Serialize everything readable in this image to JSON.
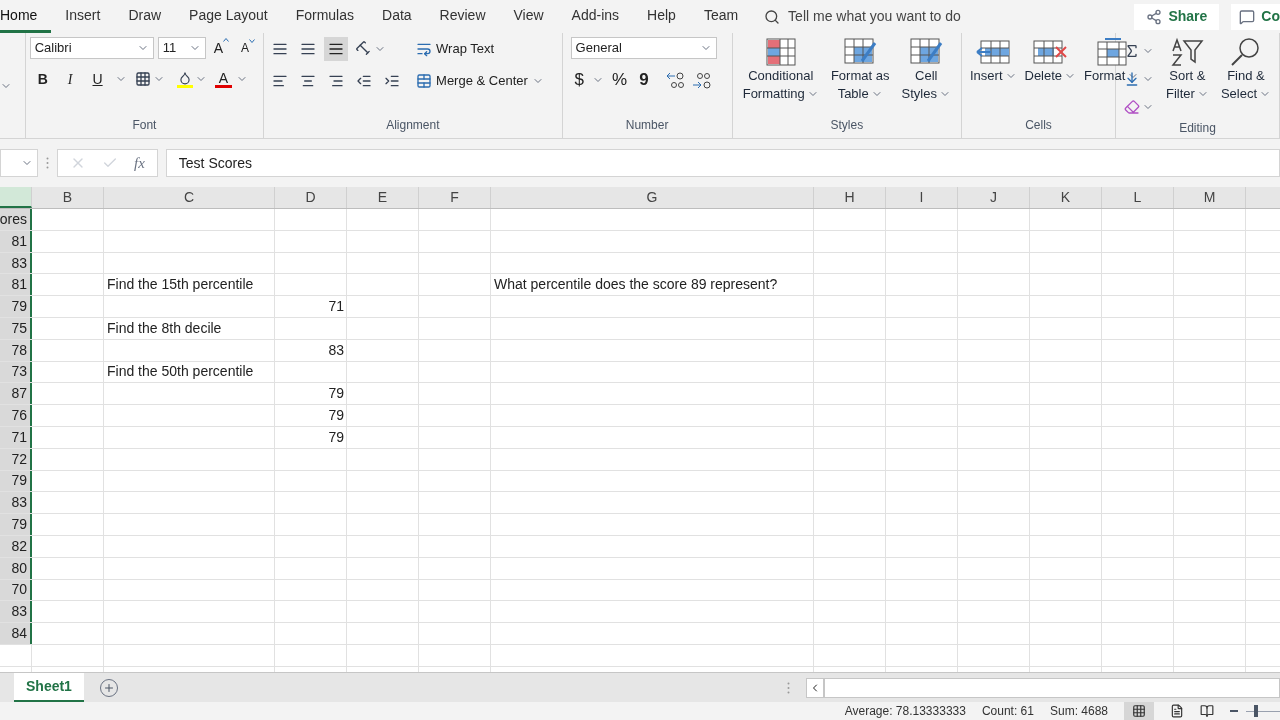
{
  "menu_tabs": [
    {
      "label": "Home",
      "selected": true
    },
    {
      "label": "Insert",
      "selected": false
    },
    {
      "label": "Draw",
      "selected": false
    },
    {
      "label": "Page Layout",
      "selected": false
    },
    {
      "label": "Formulas",
      "selected": false
    },
    {
      "label": "Data",
      "selected": false
    },
    {
      "label": "Review",
      "selected": false
    },
    {
      "label": "View",
      "selected": false
    },
    {
      "label": "Add-ins",
      "selected": false
    },
    {
      "label": "Help",
      "selected": false
    },
    {
      "label": "Team",
      "selected": false
    }
  ],
  "tell_me": {
    "placeholder": "Tell me what you want to do"
  },
  "share_button": "Share",
  "comments_button": "Co",
  "ribbon": {
    "font": {
      "label": "Font",
      "font_name": "Calibri",
      "font_size": "11",
      "grow": "A",
      "shrink": "A",
      "bold": "B",
      "italic": "I",
      "underline": "U",
      "font_color": "A"
    },
    "alignment": {
      "label": "Alignment",
      "wrap_text": "Wrap Text",
      "merge_center": "Merge & Center"
    },
    "number": {
      "label": "Number",
      "format": "General",
      "currency": "$",
      "percent": "%",
      "comma": "9"
    },
    "styles": {
      "label": "Styles",
      "buttons": [
        {
          "kind": "conditional",
          "lines": [
            "Conditional",
            "Formatting"
          ]
        },
        {
          "kind": "table",
          "lines": [
            "Format as",
            "Table"
          ]
        },
        {
          "kind": "cellstyles",
          "lines": [
            "Cell",
            "Styles"
          ]
        }
      ]
    },
    "cells": {
      "label": "Cells",
      "buttons": [
        {
          "kind": "insert",
          "lines": [
            "Insert"
          ]
        },
        {
          "kind": "delete",
          "lines": [
            "Delete"
          ]
        },
        {
          "kind": "format",
          "lines": [
            "Format"
          ]
        }
      ]
    },
    "editing": {
      "label": "Editing",
      "buttons": [
        {
          "kind": "sort",
          "lines": [
            "Sort &",
            "Filter"
          ]
        },
        {
          "kind": "find",
          "lines": [
            "Find &",
            "Select"
          ]
        }
      ]
    }
  },
  "formula_bar": {
    "function_label": "fx",
    "value": "Test Scores"
  },
  "columns": [
    {
      "selected": true
    },
    {
      "label": "B",
      "selected": false
    },
    {
      "label": "C",
      "selected": false
    },
    {
      "label": "D",
      "selected": false
    },
    {
      "label": "E",
      "selected": false
    },
    {
      "label": "F",
      "selected": false
    },
    {
      "label": "G",
      "selected": false
    },
    {
      "label": "H",
      "selected": false
    },
    {
      "label": "I",
      "selected": false
    },
    {
      "label": "J",
      "selected": false
    },
    {
      "label": "K",
      "selected": false
    },
    {
      "label": "L",
      "selected": false
    },
    {
      "label": "M",
      "selected": false
    }
  ],
  "rows": [
    {
      "column_a": "ores"
    },
    {
      "column_a": "81"
    },
    {
      "column_a": "83"
    },
    {
      "column_a": "81",
      "C": "Find the 15th percentile",
      "G": "What percentile does the score 89 represent?"
    },
    {
      "column_a": "79",
      "D": "71"
    },
    {
      "column_a": "75",
      "C": "Find the 8th decile"
    },
    {
      "column_a": "78",
      "D": "83"
    },
    {
      "column_a": "73",
      "C": "Find the 50th percentile"
    },
    {
      "column_a": "87",
      "D": "79"
    },
    {
      "column_a": "76",
      "D": "79"
    },
    {
      "column_a": "71",
      "D": "79"
    },
    {
      "column_a": "72"
    },
    {
      "column_a": "79"
    },
    {
      "column_a": "83"
    },
    {
      "column_a": "79"
    },
    {
      "column_a": "82"
    },
    {
      "column_a": "80"
    },
    {
      "column_a": "70"
    },
    {
      "column_a": "83"
    },
    {
      "column_a": "84"
    }
  ],
  "sheet_tabs": [
    {
      "label": "Sheet1",
      "selected": true
    }
  ],
  "status_bar": {
    "average": "Average: 78.13333333",
    "count": "Count: 61",
    "sum": "Sum: 4688"
  },
  "zoom_slider": {
    "level": 0.3
  }
}
